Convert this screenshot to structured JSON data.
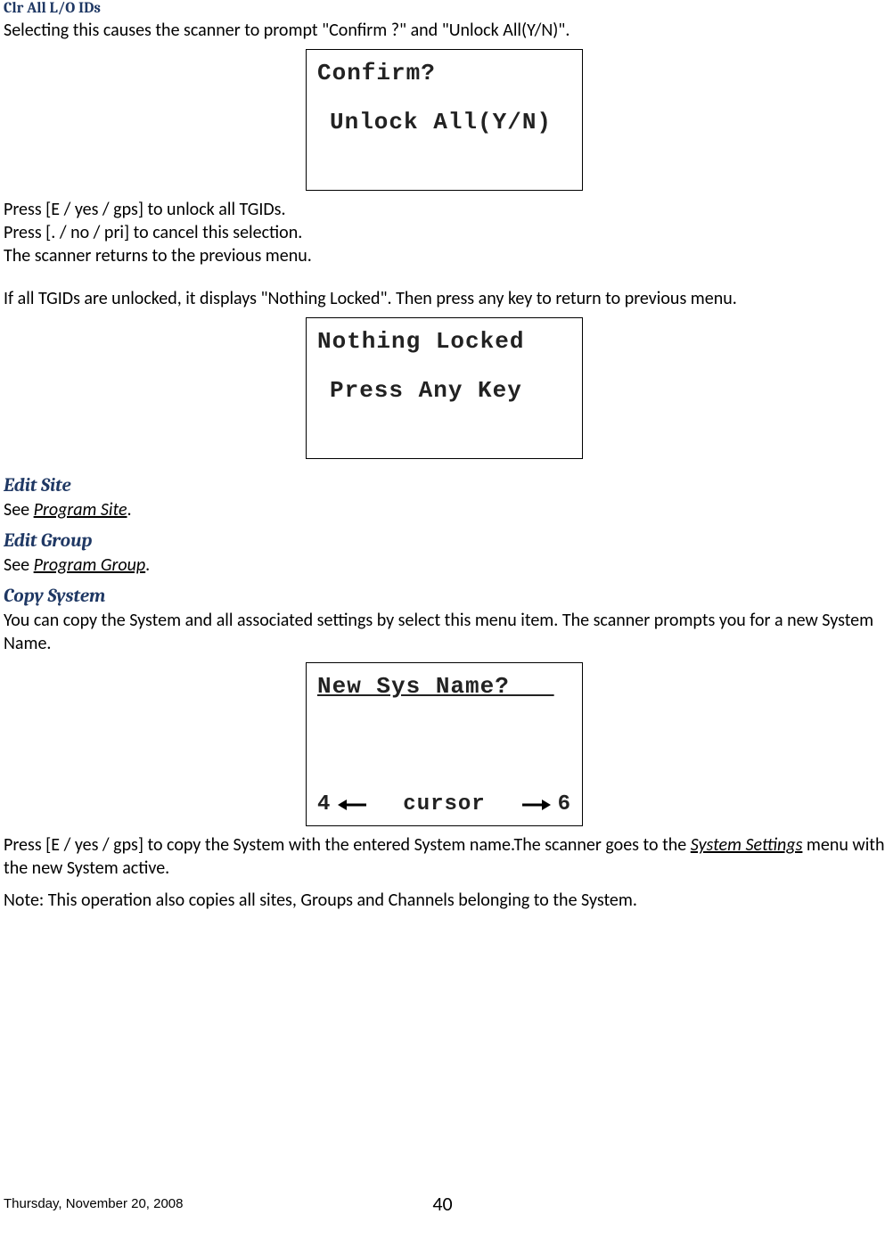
{
  "headings": {
    "clr_all": "Clr All L/O IDs",
    "edit_site": "Edit Site",
    "edit_group": "Edit Group",
    "copy_system": "Copy System"
  },
  "paragraphs": {
    "clr_intro": "Selecting this causes the scanner to prompt \"Confirm ?\" and \"Unlock All(Y/N)\".",
    "press_e": "Press [E / yes / gps] to unlock all TGIDs.",
    "press_no": "Press [. / no / pri] to cancel this selection.",
    "scanner_returns": "The scanner returns to the previous menu.",
    "if_unlocked": "If all TGIDs are unlocked, it displays \"Nothing Locked\". Then press any key to return to previous menu.",
    "see": "See ",
    "program_site": "Program Site",
    "program_group": "Program Group",
    "period": ".",
    "copy_intro": "You can copy the System and all associated settings by select this menu item. The scanner prompts you for a new System Name.",
    "press_e_copy_a": "Press [E / yes / gps] to copy the System with the entered System name.The scanner goes to the ",
    "system_settings": "System Settings",
    "press_e_copy_b": " menu with the new System active.",
    "note": "Note: This operation also copies  all sites, Groups and Channels belonging  to the System."
  },
  "lcd1": {
    "l1": "Confirm?",
    "l2": "Unlock All(Y/N)"
  },
  "lcd2": {
    "l1": "Nothing Locked",
    "l2": "Press Any Key"
  },
  "lcd3": {
    "l1": "New Sys Name?   ",
    "left_num": "4",
    "cursor": "cursor",
    "right_num": "6"
  },
  "footer": {
    "date": "Thursday, November 20, 2008",
    "page": "40"
  }
}
